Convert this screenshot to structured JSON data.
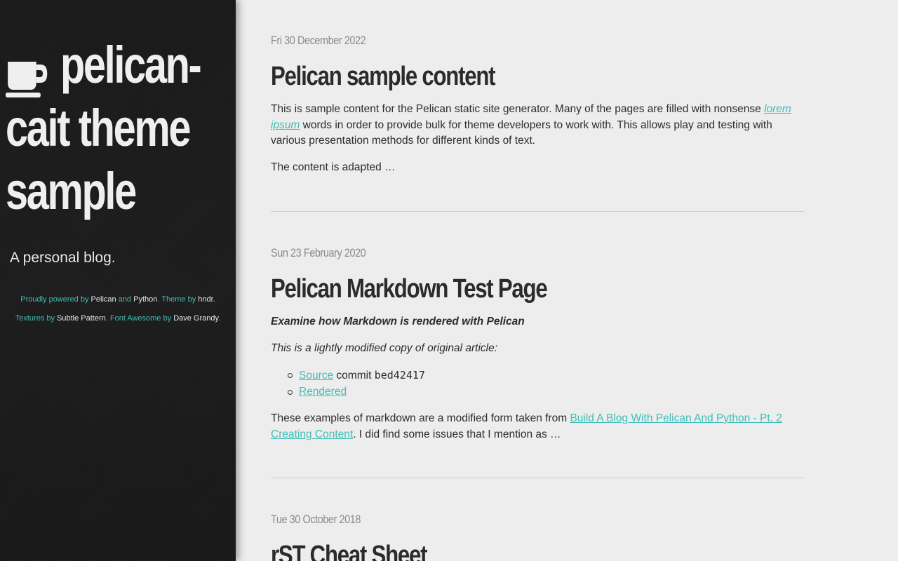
{
  "sidebar": {
    "title": "pelican-cait theme sample",
    "tagline": "A personal blog.",
    "credits": {
      "powered_prefix": "Proudly powered by",
      "pelican": "Pelican",
      "and": "and",
      "python": "Python",
      "dot1": ".",
      "theme_by": "Theme by",
      "hndr": "hndr",
      "dot2": ".",
      "textures_by": "Textures by",
      "subtle_pattern": "Subtle Pattern",
      "dot3": ".",
      "font_awesome_by": "Font Awesome by",
      "dave_grandy": "Dave Grandy",
      "dot4": "."
    }
  },
  "posts": [
    {
      "date": "Fri 30 December 2022",
      "title": "Pelican sample content",
      "p1_before": "This is sample content for the Pelican static site generator. Many of the pages are filled with nonsense ",
      "p1_link": "lorem ipsum",
      "p1_after": " words in order to provide bulk for theme developers to work with. This allows play and testing with various presentation methods for different kinds of text.",
      "p2": "The content is adapted …"
    },
    {
      "date": "Sun 23 February 2020",
      "title": "Pelican Markdown Test Page",
      "intro_bold": "Examine how Markdown is rendered with Pelican",
      "intro_italic": "This is a lightly modified copy of original article:",
      "list": {
        "source_link": "Source",
        "commit_text": " commit ",
        "commit_hash": "bed42417",
        "rendered_link": "Rendered"
      },
      "p_before": "These examples of markdown are a modified form taken from ",
      "p_link": "Build A Blog With Pelican And Python - Pt. 2 Creating Content",
      "p_after": ". I did find some issues that I mention as …"
    },
    {
      "date": "Tue 30 October 2018",
      "title": "rST Cheat Sheet"
    }
  ],
  "colors": {
    "accent": "#41bdb8",
    "sidebar_bg": "#1d1d1d",
    "page_bg": "#ededed",
    "date": "#8b8b84"
  },
  "icons": {
    "site_icon": "coffee-cup-icon"
  }
}
